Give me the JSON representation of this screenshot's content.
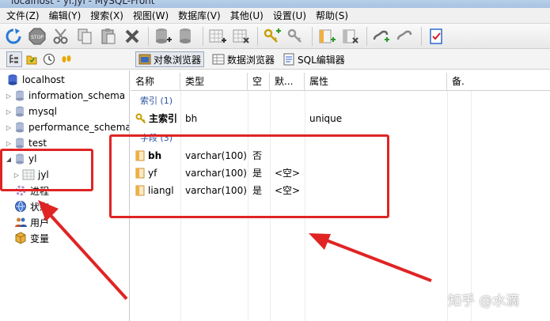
{
  "window": {
    "title": "localhost - yl.jyl - MySQL-Front"
  },
  "menubar": {
    "items": [
      "文件(Z)",
      "编辑(Y)",
      "搜索(X)",
      "视图(W)",
      "数据库(V)",
      "其他(U)",
      "设置(U)",
      "帮助(S)"
    ]
  },
  "toolbar": {
    "icons": [
      "refresh-icon",
      "stop-icon",
      "cut-icon",
      "copy-icon",
      "paste-icon",
      "delete-icon",
      "create-database-icon",
      "drop-database-icon",
      "create-table-icon",
      "drop-table-icon",
      "create-key-icon",
      "drop-key-icon",
      "create-field-icon",
      "drop-field-icon",
      "create-foreign-key-icon",
      "drop-foreign-key-icon",
      "properties-icon"
    ]
  },
  "tabs": {
    "object_browser": "对象浏览器",
    "data_browser": "数据浏览器",
    "sql_editor": "SQL编辑器"
  },
  "sidebar": {
    "items": [
      {
        "label": "localhost",
        "icon": "server-icon",
        "level": 0,
        "arrow": ""
      },
      {
        "label": "information_schema",
        "icon": "database-icon",
        "level": 1,
        "arrow": "▷"
      },
      {
        "label": "mysql",
        "icon": "database-icon",
        "level": 1,
        "arrow": "▷"
      },
      {
        "label": "performance_schema",
        "icon": "database-icon",
        "level": 1,
        "arrow": "▷"
      },
      {
        "label": "test",
        "icon": "database-icon",
        "level": 1,
        "arrow": "▷"
      },
      {
        "label": "yl",
        "icon": "database-icon",
        "level": 1,
        "arrow": "◢"
      },
      {
        "label": "jyl",
        "icon": "table-icon",
        "level": 2,
        "arrow": "▷"
      },
      {
        "label": "进程",
        "icon": "process-icon",
        "level": 1,
        "arrow": ""
      },
      {
        "label": "状态",
        "icon": "status-icon",
        "level": 1,
        "arrow": ""
      },
      {
        "label": "用户",
        "icon": "users-icon",
        "level": 1,
        "arrow": ""
      },
      {
        "label": "变量",
        "icon": "variables-icon",
        "level": 1,
        "arrow": ""
      }
    ]
  },
  "main": {
    "columns": [
      "名称",
      "类型",
      "空",
      "默...",
      "属性",
      "备."
    ],
    "index_group": "索引 (1)",
    "indexes": [
      {
        "name": "主索引",
        "type": "bh",
        "null": "",
        "default": "",
        "attribute": "unique"
      }
    ],
    "field_group": "字段 (3)",
    "fields": [
      {
        "name": "bh",
        "type": "varchar(100)",
        "null": "否",
        "default": "",
        "bold": true
      },
      {
        "name": "yf",
        "type": "varchar(100)",
        "null": "是",
        "default": "<空>"
      },
      {
        "name": "liangl",
        "type": "varchar(100)",
        "null": "是",
        "default": "<空>"
      }
    ]
  },
  "annotation": {
    "color": "#e02424"
  },
  "watermark": "知乎 @水滴"
}
